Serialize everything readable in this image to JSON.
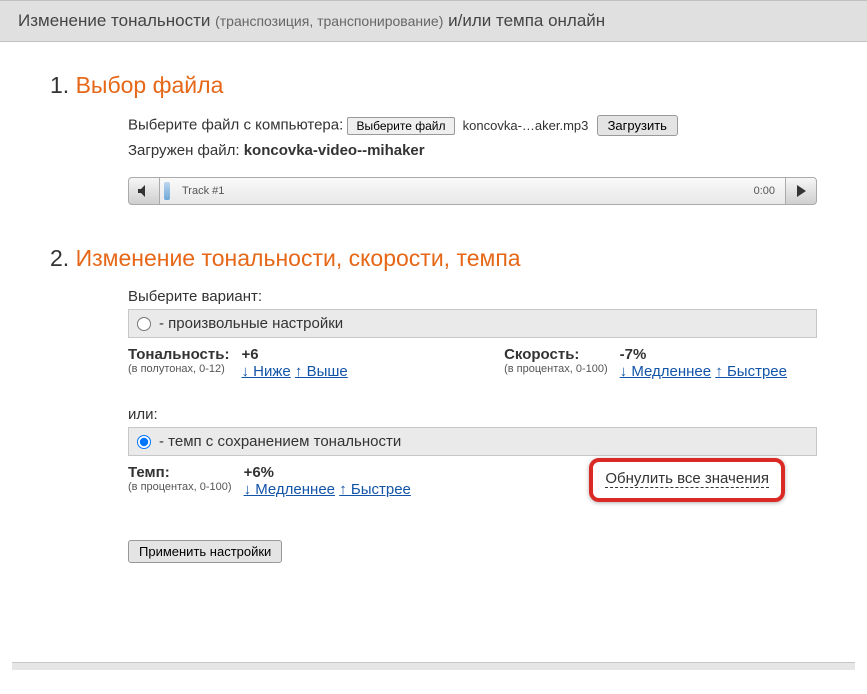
{
  "header": {
    "main": "Изменение тональности ",
    "sub": "(транспозиция, транспонирование)",
    "tail": " и/или темпа онлайн"
  },
  "section1": {
    "num": "1. ",
    "title": "Выбор файла",
    "choose_label": "Выберите файл с компьютера: ",
    "choose_btn": "Выберите файл",
    "filename_short": "koncovka-…aker.mp3",
    "upload_btn": "Загрузить",
    "loaded_label": "Загружен файл: ",
    "loaded_name": "koncovka-video--mihaker",
    "track_label": "Track #1",
    "track_time": "0:00"
  },
  "section2": {
    "num": "2. ",
    "title": "Изменение тональности, скорости, темпа",
    "choose_variant": "Выберите вариант:",
    "opt1": " - произвольные настройки",
    "tonality_label": "Тональность:",
    "tonality_note": "(в полутонах, 0-12)",
    "tonality_value": "+6",
    "lower": "↓ Ниже",
    "higher": "↑ Выше",
    "speed_label": "Скорость:",
    "speed_note": "(в процентах, 0-100)",
    "speed_value": "-7%",
    "slower": "↓ Медленнее",
    "faster": "↑ Быстрее",
    "or_label": "или:",
    "opt2": " - темп с сохранением тональности",
    "tempo_label": "Темп:",
    "tempo_note": "(в процентах, 0-100)",
    "tempo_value": "+6%",
    "reset": "Обнулить все значения",
    "apply": "Применить настройки"
  }
}
